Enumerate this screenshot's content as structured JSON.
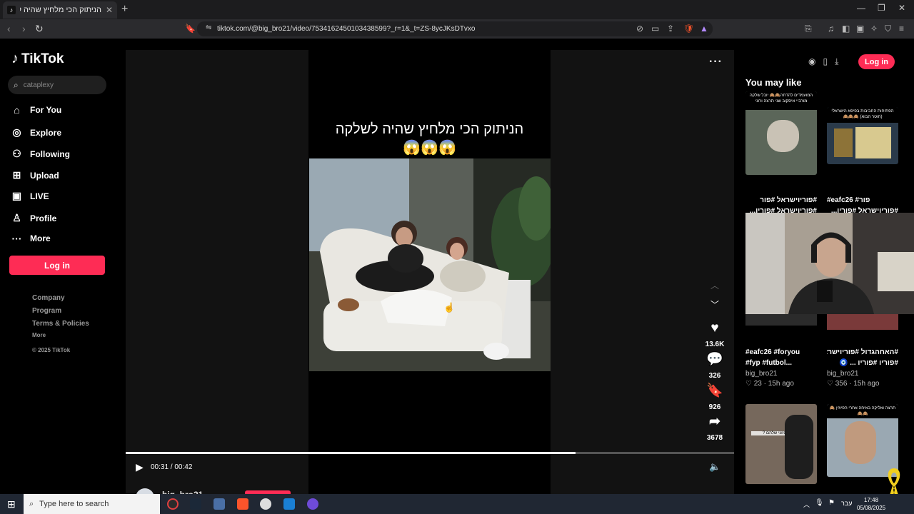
{
  "browser": {
    "tab_title": "הניתוק הכי מלחיץ שהיה לשלקה",
    "url": "tiktok.com/@big_bro21/video/7534162450103438599?_r=1&_t=ZS-8ycJKsDTvxo"
  },
  "sidebar": {
    "brand": "TikTok",
    "search_placeholder": "cataplexy",
    "nav": [
      {
        "label": "For You",
        "icon": "home-icon"
      },
      {
        "label": "Explore",
        "icon": "compass-icon"
      },
      {
        "label": "Following",
        "icon": "following-icon"
      },
      {
        "label": "Upload",
        "icon": "upload-icon"
      },
      {
        "label": "LIVE",
        "icon": "live-icon"
      },
      {
        "label": "Profile",
        "icon": "profile-icon"
      },
      {
        "label": "More",
        "icon": "more-dots-icon"
      }
    ],
    "login_label": "Log in",
    "footer": {
      "company": "Company",
      "program": "Program",
      "terms": "Terms & Policies",
      "more": "More",
      "copyright": "© 2025 TikTok"
    }
  },
  "video": {
    "caption_line1": "הניתוק הכי מלחיץ שהיה לשלקה",
    "caption_line2": "😱😱😱",
    "likes": "13.6K",
    "comments": "326",
    "saves": "926",
    "shares": "3678",
    "time": "00:31 / 00:42",
    "progress": 0.74,
    "author": "big_bro21"
  },
  "right": {
    "login_label": "Log in",
    "section_title": "You may like",
    "cards": [
      {
        "caption1": "#פוריוישראל #פור",
        "caption2": "#פוריוישראל #פוריו...",
        "thumb_text": "המועמדים להדחה🙈🙈 יובל שלקה מורביי איסקוב שני תרצה ורוני"
      },
      {
        "caption1": "#eafc26 #פור",
        "caption2": "#פוריוישראל #פוריו...",
        "thumb_text": "הפתיחות החביבות בפיפא הישראלי (חוטר הבוא) 🙈🙈🙈"
      },
      {
        "caption1": "#eafc26 #foryou",
        "caption2": "#fyp #futbol...",
        "author": "big_bro21",
        "likes": "23",
        "age": "15h ago"
      },
      {
        "caption1": "#האחהגדול #פוריוישראל",
        "caption2": "#פוריו #פוריו ... 🧿",
        "author": "big_bro21",
        "likes": "356",
        "age": "15h ago"
      },
      {
        "thumb_text": "האם זה הזוגי שלהם ?"
      },
      {
        "thumb_text": "תרצה ואליקה באיחה אחרי הפיוזין 🙈🙈🙈"
      }
    ]
  },
  "taskbar": {
    "search_placeholder": "Type here to search",
    "lang": "עבר",
    "time": "17:48",
    "date": "05/08/2025"
  }
}
